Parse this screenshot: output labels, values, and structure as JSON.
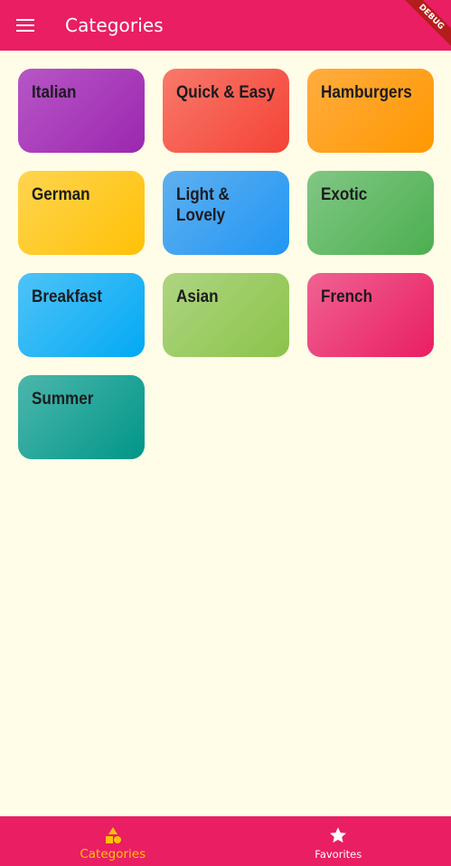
{
  "app_bar": {
    "title": "Categories",
    "menu_icon": "menu-icon",
    "background_color": "#e91e63"
  },
  "debug_banner": {
    "label": "DEBUG"
  },
  "categories": [
    {
      "label": "Italian",
      "color_start": "#b756c6",
      "color_end": "#9c27b0"
    },
    {
      "label": "Quick & Easy",
      "color_start": "#f8796b",
      "color_end": "#f44336"
    },
    {
      "label": "Hamburgers",
      "color_start": "#ffac40",
      "color_end": "#ff9800"
    },
    {
      "label": "German",
      "color_start": "#ffd54f",
      "color_end": "#ffc107"
    },
    {
      "label": "Light & Lovely",
      "color_start": "#5fb0f0",
      "color_end": "#2196f3"
    },
    {
      "label": "Exotic",
      "color_start": "#81c784",
      "color_end": "#4caf50"
    },
    {
      "label": "Breakfast",
      "color_start": "#4fc3f7",
      "color_end": "#03a9f4"
    },
    {
      "label": "Asian",
      "color_start": "#aed581",
      "color_end": "#8bc34a"
    },
    {
      "label": "French",
      "color_start": "#f06292",
      "color_end": "#e91e63"
    },
    {
      "label": "Summer",
      "color_start": "#4db6ac",
      "color_end": "#009688"
    }
  ],
  "bottom_nav": {
    "items": [
      {
        "label": "Categories",
        "icon": "category-icon",
        "active": true
      },
      {
        "label": "Favorites",
        "icon": "star-icon",
        "active": false
      }
    ],
    "active_color": "#ffc107",
    "inactive_color": "#ffffff"
  },
  "background_color": "#fffde7"
}
